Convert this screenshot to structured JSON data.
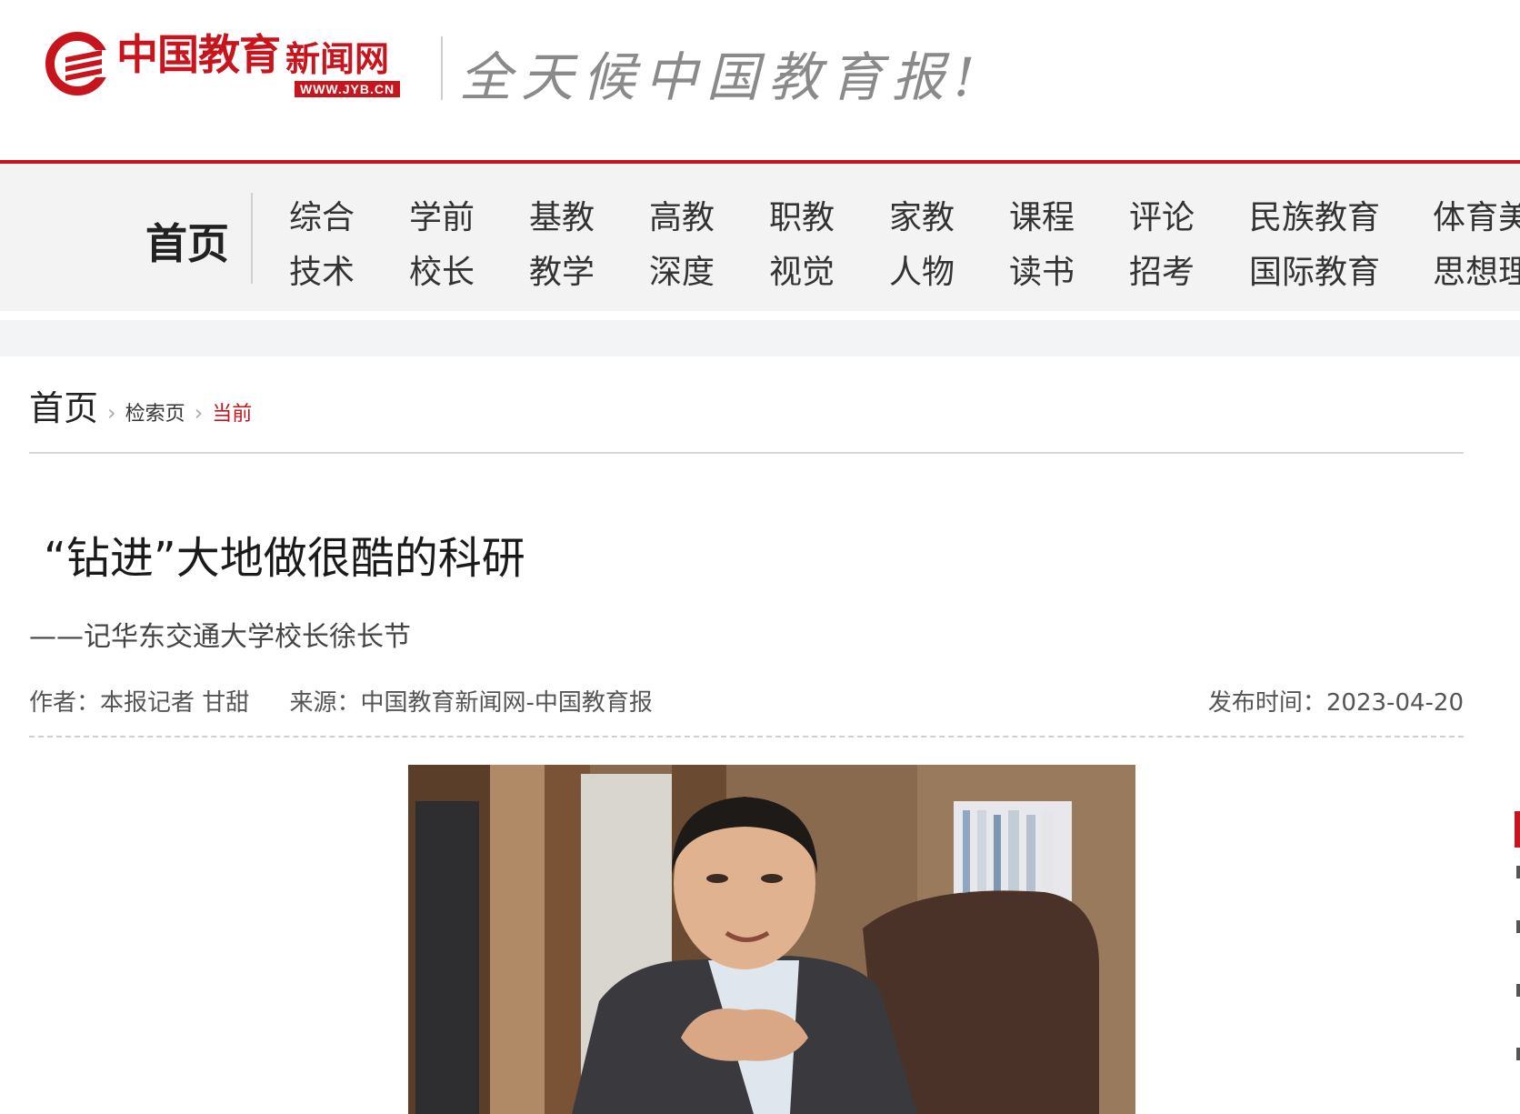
{
  "header": {
    "logo_name": "中国教育",
    "logo_net": "新闻网",
    "logo_url": "WWW.JYB.CN",
    "slogan": "全天候中国教育报!",
    "brand_color": "#c8151d"
  },
  "nav": {
    "home": "首页",
    "columns": [
      [
        "综合",
        "技术"
      ],
      [
        "学前",
        "校长"
      ],
      [
        "基教",
        "教学"
      ],
      [
        "高教",
        "深度"
      ],
      [
        "职教",
        "视觉"
      ],
      [
        "家教",
        "人物"
      ],
      [
        "课程",
        "读书"
      ],
      [
        "评论",
        "招考"
      ],
      [
        "民族教育",
        "国际教育"
      ],
      [
        "体育美",
        "思想理"
      ]
    ]
  },
  "breadcrumb": {
    "home": "首页",
    "search": "检索页",
    "current": "当前"
  },
  "article": {
    "title": "“钻进”大地做很酷的科研",
    "subtitle": "——记华东交通大学校长徐长节",
    "author": "作者：本报记者 甘甜",
    "source": "来源：中国教育新闻网-中国教育报",
    "publish_time": "发布时间：2023-04-20"
  }
}
